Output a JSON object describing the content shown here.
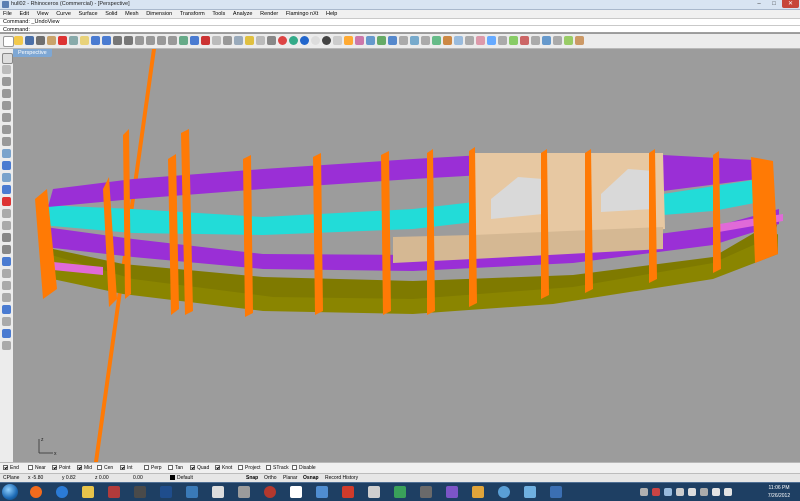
{
  "window": {
    "title": "hull02 - Rhinoceros (Commercial) - [Perspective]",
    "min": "–",
    "max": "□",
    "close": "✕"
  },
  "menu": [
    "File",
    "Edit",
    "View",
    "Curve",
    "Surface",
    "Solid",
    "Mesh",
    "Dimension",
    "Transform",
    "Tools",
    "Analyze",
    "Render",
    "Flamingo nXt",
    "Help"
  ],
  "command": {
    "history": "Command: _UndoView",
    "prompt": "Command:",
    "value": ""
  },
  "viewport": {
    "title": "Perspective",
    "axis_z": "z",
    "axis_x": "x"
  },
  "osnaps": [
    {
      "label": "End",
      "checked": true
    },
    {
      "label": "Near",
      "checked": false
    },
    {
      "label": "Point",
      "checked": true
    },
    {
      "label": "Mid",
      "checked": true
    },
    {
      "label": "Cen",
      "checked": false
    },
    {
      "label": "Int",
      "checked": true
    },
    {
      "label": "Perp",
      "checked": false
    },
    {
      "label": "Tan",
      "checked": false
    },
    {
      "label": "Quad",
      "checked": true
    },
    {
      "label": "Knot",
      "checked": true
    },
    {
      "label": "Project",
      "checked": false
    },
    {
      "label": "STrack",
      "checked": false
    },
    {
      "label": "Disable",
      "checked": false
    }
  ],
  "status": {
    "cplane": "CPlane",
    "x": "x -5.80",
    "y": "y 0.82",
    "z": "z 0.00",
    "extra": "0.00",
    "layer": "Default",
    "snap": "Snap",
    "ortho": "Ortho",
    "planar": "Planar",
    "osnap": "Osnap",
    "record": "Record History"
  },
  "taskbar": {
    "time": "11:06 PM",
    "date": "7/26/2012"
  },
  "colors": {
    "purple": "#9a2fd6",
    "cyan": "#22dcd8",
    "olive": "#7f7a00",
    "orange": "#ff7a05",
    "tan": "#e7c8a2"
  }
}
